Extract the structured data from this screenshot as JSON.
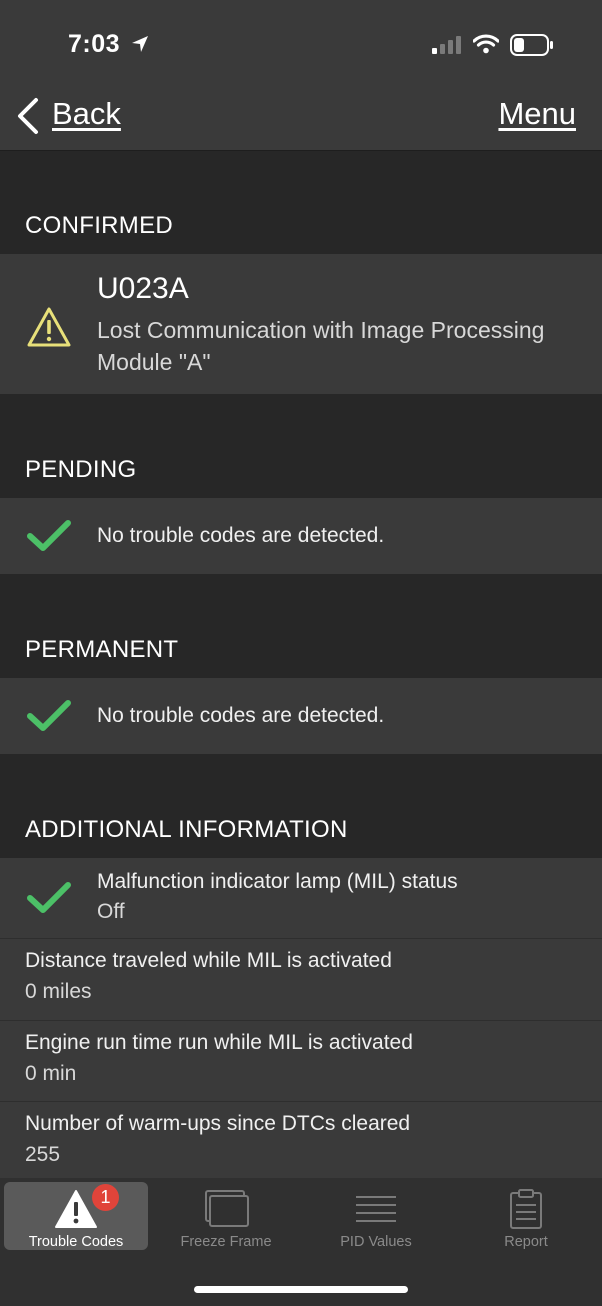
{
  "status_bar": {
    "time": "7:03"
  },
  "nav": {
    "back_label": "Back",
    "menu_label": "Menu"
  },
  "sections": {
    "confirmed": {
      "title": "CONFIRMED",
      "code": "U023A",
      "description": "Lost Communication with Image Processing Module \"A\""
    },
    "pending": {
      "title": "PENDING",
      "message": "No trouble codes are detected."
    },
    "permanent": {
      "title": "PERMANENT",
      "message": "No trouble codes are detected."
    },
    "additional": {
      "title": "ADDITIONAL INFORMATION",
      "mil_label": "Malfunction indicator lamp (MIL) status",
      "mil_value": "Off",
      "distance_label": "Distance traveled while MIL is activated",
      "distance_value": "0 miles",
      "runtime_label": "Engine run time run while MIL is activated",
      "runtime_value": "0 min",
      "warmups_label": "Number of warm-ups since DTCs cleared",
      "warmups_value": "255"
    }
  },
  "tabs": [
    {
      "label": "Trouble Codes",
      "badge": "1",
      "icon": "warning-icon"
    },
    {
      "label": "Freeze Frame",
      "icon": "freeze-frame-icon"
    },
    {
      "label": "PID Values",
      "icon": "list-icon"
    },
    {
      "label": "Report",
      "icon": "clipboard-icon"
    }
  ],
  "colors": {
    "check_green": "#4cc067",
    "warning_yellow": "#e8e07a",
    "badge_red": "#e0443a",
    "row_bg": "#3a3a3a",
    "page_bg": "#272727"
  }
}
